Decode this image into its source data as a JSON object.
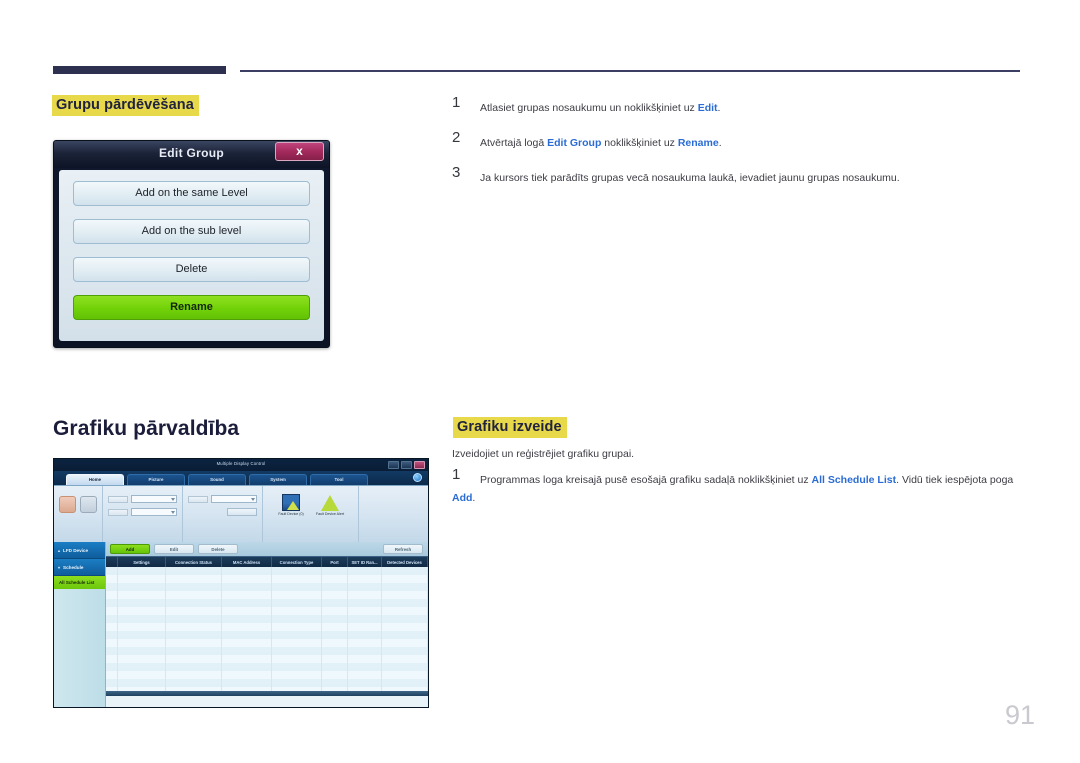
{
  "page": {
    "number": "91"
  },
  "section_rename": {
    "heading": "Grupu pārdēvēšana",
    "steps": [
      {
        "num": "1",
        "html": "Atlasiet grupas nosaukumu un noklikšķiniet uz <b>Edit</b>."
      },
      {
        "num": "2",
        "html": "Atvērtajā logā <b>Edit Group</b> noklikšķiniet uz <b>Rename</b>."
      },
      {
        "num": "3",
        "html": "Ja kursors tiek parādīts grupas vecā nosaukuma laukā, ievadiet jaunu grupas nosaukumu."
      }
    ]
  },
  "dialog": {
    "title": "Edit Group",
    "close_label": "x",
    "buttons": [
      {
        "label": "Add on the same Level",
        "primary": false
      },
      {
        "label": "Add on the sub level",
        "primary": false
      },
      {
        "label": "Delete",
        "primary": false
      },
      {
        "label": "Rename",
        "primary": true
      }
    ]
  },
  "section_schedule": {
    "title": "Grafiku pārvaldība",
    "heading": "Grafiku izveide",
    "note": "Izveidojiet un reģistrējiet grafiku grupai.",
    "steps": [
      {
        "num": "1",
        "html": "Programmas loga kreisajā pusē esošajā grafiku sadaļā noklikšķiniet uz <b>All Schedule List</b>. Vidū tiek iespējota poga <b>Add</b>."
      }
    ]
  },
  "app": {
    "title": "Multiple Display Control",
    "window_buttons": [
      "minimize",
      "maximize",
      "close"
    ],
    "help_icon": "help-icon",
    "tabs": [
      {
        "label": "Home",
        "active": true
      },
      {
        "label": "Picture",
        "active": false
      },
      {
        "label": "Sound",
        "active": false
      },
      {
        "label": "System",
        "active": false
      },
      {
        "label": "Tool",
        "active": false
      }
    ],
    "ribbon_icons": [
      {
        "label": "Fault Device (0)",
        "icon": "fault-device-icon"
      },
      {
        "label": "Fault Device Alert",
        "icon": "fault-device-alert-icon"
      }
    ],
    "sidebar": {
      "items": [
        {
          "label": "LFD Device",
          "caret": "▴"
        },
        {
          "label": "Schedule",
          "caret": "▾"
        }
      ],
      "selected": "All Schedule List"
    },
    "toolbar_buttons": [
      {
        "label": "Add",
        "state": "enabled"
      },
      {
        "label": "Edit",
        "state": "disabled"
      },
      {
        "label": "Delete",
        "state": "disabled"
      }
    ],
    "toolbar_right_button": {
      "label": "Refresh",
      "state": "disabled"
    },
    "grid": {
      "columns": [
        {
          "label": "",
          "width": 12
        },
        {
          "label": "Settings",
          "width": 48
        },
        {
          "label": "Connection Status",
          "width": 56
        },
        {
          "label": "MAC Address",
          "width": 50
        },
        {
          "label": "Connection Type",
          "width": 50
        },
        {
          "label": "Port",
          "width": 26
        },
        {
          "label": "SET ID Ran...",
          "width": 34
        },
        {
          "label": "Detected Devices",
          "width": 46
        }
      ],
      "row_count": 16,
      "rows": []
    }
  },
  "colors": {
    "rule": "#2e3050",
    "highlight": "#e8d94a",
    "link": "#2a6cd4",
    "heading_text": "#1b1d3a",
    "page_number": "#c9c9cf",
    "dialog_primary": "#72d208",
    "dialog_close": "#a32a5c"
  }
}
